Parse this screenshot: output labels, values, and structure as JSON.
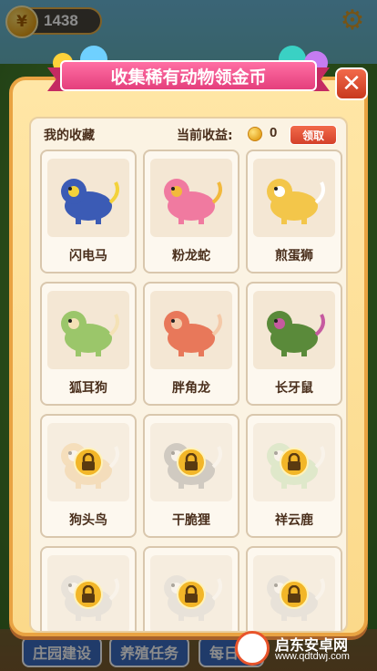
{
  "hud": {
    "coins": "1438",
    "coin_symbol": "¥"
  },
  "modal": {
    "title": "收集稀有动物领金币",
    "my_collection_label": "我的收藏",
    "income_label": "当前收益:",
    "income_value": "0",
    "claim_label": "领取",
    "close_label": "✕"
  },
  "animals": [
    {
      "name": "闪电马",
      "locked": false,
      "icon": "blue-lightning-horse"
    },
    {
      "name": "粉龙蛇",
      "locked": false,
      "icon": "pink-dragon-snake"
    },
    {
      "name": "煎蛋狮",
      "locked": false,
      "icon": "fried-egg-lion"
    },
    {
      "name": "狐耳狗",
      "locked": false,
      "icon": "fox-ear-dog"
    },
    {
      "name": "胖角龙",
      "locked": false,
      "icon": "chubby-triceratops"
    },
    {
      "name": "长牙鼠",
      "locked": false,
      "icon": "spiky-tusk-rat"
    },
    {
      "name": "狗头鸟",
      "locked": true,
      "icon": "dog-head-bird"
    },
    {
      "name": "干脆狸",
      "locked": true,
      "icon": "raccoon"
    },
    {
      "name": "祥云鹿",
      "locked": true,
      "icon": "cloud-deer"
    },
    {
      "name": "",
      "locked": true,
      "icon": "locked-creature"
    },
    {
      "name": "",
      "locked": true,
      "icon": "locked-creature"
    },
    {
      "name": "",
      "locked": true,
      "icon": "locked-creature"
    }
  ],
  "bottom_tabs": [
    "庄园建设",
    "养殖任务",
    "每日任"
  ],
  "watermark": {
    "line1": "启东安卓网",
    "line2": "www.qdtdwj.com"
  },
  "colors": {
    "accent_pink": "#e43f7c",
    "frame_orange": "#e9a342",
    "claim_red": "#d4412a"
  }
}
